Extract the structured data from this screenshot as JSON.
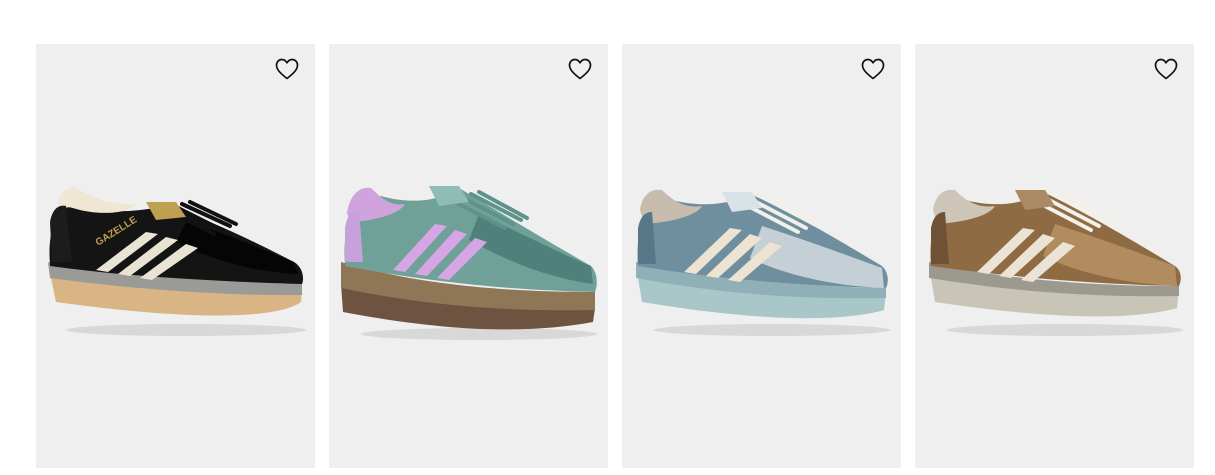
{
  "products": [
    {
      "name": "black-suede-gazelle",
      "colors": {
        "upper": "#141414",
        "upper_shade": "#050505",
        "stripe": "#e9e3d3",
        "collar": "#efe6d3",
        "heel": "#1c1c1c",
        "sole_top": "#9a9a97",
        "sole_bottom": "#d9b586",
        "laces": "#111111",
        "detail": "#bfa050"
      },
      "lettering": "GAZELLE",
      "favorite_icon": "heart-outline-icon"
    },
    {
      "name": "teal-platform-gazelle",
      "colors": {
        "upper": "#6fa199",
        "upper_shade": "#4d8179",
        "stripe": "#d5a6e3",
        "collar": "#cfa3de",
        "heel": "#c7a0dc",
        "sole_top": "#8e7656",
        "sole_bottom": "#6e5440",
        "laces": "#5f938a",
        "detail": "#8fbcb3"
      },
      "lettering": "",
      "favorite_icon": "heart-outline-icon"
    },
    {
      "name": "blue-grey-gazelle",
      "colors": {
        "upper": "#6f8e9e",
        "upper_shade": "#58788a",
        "stripe": "#ece3d3",
        "collar": "#c7bcae",
        "heel": "#c4d0d6",
        "sole_top": "#8fb0b6",
        "sole_bottom": "#a9c6c9",
        "laces": "#f2f0ea",
        "detail": "#d9e2e6"
      },
      "lettering": "",
      "favorite_icon": "heart-outline-icon"
    },
    {
      "name": "brown-woven-gazelle",
      "colors": {
        "upper": "#8f6b44",
        "upper_shade": "#6f5235",
        "stripe": "#ebe4d6",
        "collar": "#cdc5b8",
        "heel": "#a98a62",
        "sole_top": "#9c9a8f",
        "sole_bottom": "#c8c4b6",
        "laces": "#f4f1ea",
        "detail": "#b08c5f"
      },
      "lettering": "",
      "favorite_icon": "heart-outline-icon"
    }
  ]
}
